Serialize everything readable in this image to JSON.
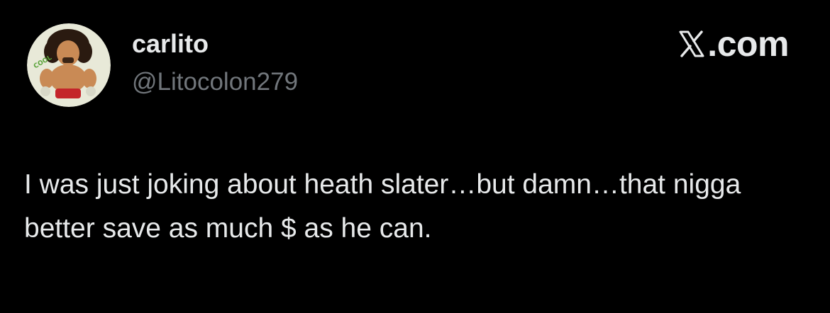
{
  "tweet": {
    "author": {
      "display_name": "carlito",
      "handle": "@Litocolon279",
      "avatar_icon": "cartoon-wrestler-avatar-icon"
    },
    "source": {
      "logo_icon": "x-logo-icon",
      "label": ".com"
    },
    "text": "I was just joking about heath slater…but damn…that nigga better save as much $ as he can."
  },
  "colors": {
    "background": "#000000",
    "primary_text": "#e7e9ea",
    "secondary_text": "#71767b",
    "avatar_bg": "#e8e9d8"
  }
}
